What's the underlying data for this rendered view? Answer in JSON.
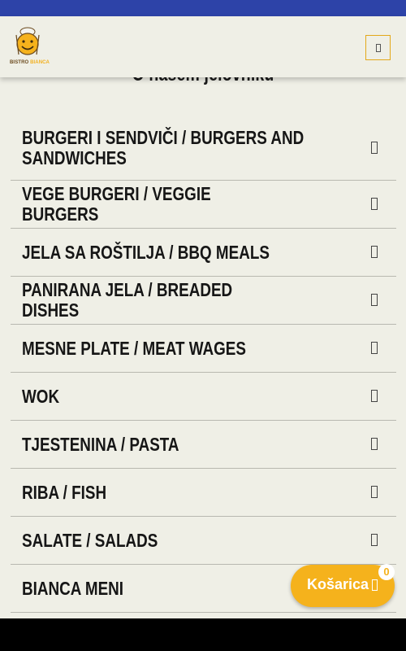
{
  "header": {
    "logo_text_primary": "BISTRO",
    "logo_text_accent": "BIANCA",
    "menu_icon": "menu-icon"
  },
  "section": {
    "title": "O našem jelovniku"
  },
  "menu_items": [
    {
      "label": "BURGERI I SENDVIČI / BURGERS AND SANDWICHES",
      "icon": "chevron-icon"
    },
    {
      "label": "VEGE BURGERI / VEGGIE BURGERS",
      "icon": "chevron-icon"
    },
    {
      "label": "JELA SA ROŠTILJA / BBQ MEALS",
      "icon": "chevron-icon"
    },
    {
      "label": "PANIRANA JELA / BREADED DISHES",
      "icon": "chevron-icon"
    },
    {
      "label": "MESNE PLATE / MEAT WAGES",
      "icon": "chevron-icon"
    },
    {
      "label": "WOK",
      "icon": "chevron-icon"
    },
    {
      "label": "TJESTENINA / PASTA",
      "icon": "chevron-icon"
    },
    {
      "label": "RIBA / FISH",
      "icon": "chevron-icon"
    },
    {
      "label": "SALATE / SALADS",
      "icon": "chevron-icon"
    },
    {
      "label": "BIANCA MENI",
      "icon": "chevron-icon"
    }
  ],
  "cart": {
    "label": "Košarica",
    "count": "0",
    "icon": "cart-icon"
  },
  "colors": {
    "accent": "#f5b21c",
    "status_bar": "#2d43a8",
    "background": "#efefe6"
  }
}
